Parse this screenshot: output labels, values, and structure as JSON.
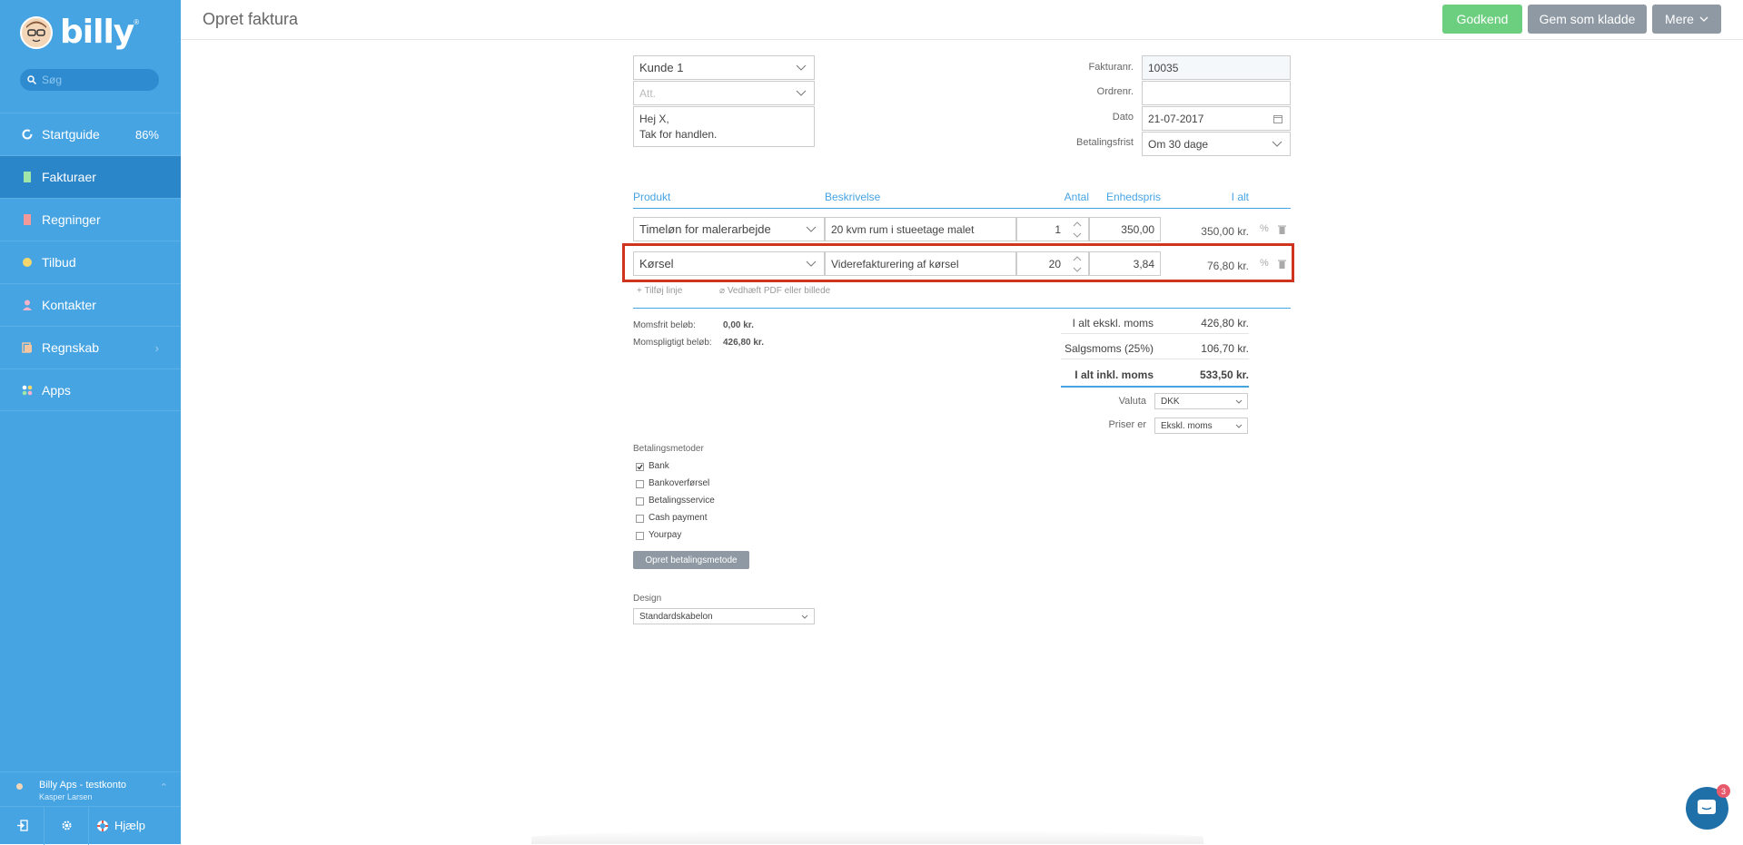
{
  "app": {
    "logo_text": "billy",
    "logo_mark": "®",
    "search_placeholder": "Søg"
  },
  "nav": [
    {
      "label": "Startguide",
      "badge": "86%",
      "icon": "progress-circle-icon"
    },
    {
      "label": "Fakturaer",
      "icon": "document-icon",
      "active": true
    },
    {
      "label": "Regninger",
      "icon": "bill-icon"
    },
    {
      "label": "Tilbud",
      "icon": "gear-badge-icon"
    },
    {
      "label": "Kontakter",
      "icon": "person-icon"
    },
    {
      "label": "Regnskab",
      "icon": "ledger-icon"
    },
    {
      "label": "Apps",
      "icon": "apps-icon"
    }
  ],
  "account": {
    "company": "Billy Aps - testkonto",
    "user": "Kasper Larsen"
  },
  "bottom": {
    "help": "Hjælp"
  },
  "header": {
    "title": "Opret faktura",
    "approve": "Godkend",
    "save_draft": "Gem som kladde",
    "more": "Mere"
  },
  "customer": {
    "name": "Kunde 1",
    "att_placeholder": "Att.",
    "message_line1": "Hej X,",
    "message_line2": "Tak for handlen."
  },
  "meta": {
    "invoice_no_label": "Fakturanr.",
    "invoice_no": "10035",
    "order_no_label": "Ordrenr.",
    "order_no": "",
    "date_label": "Dato",
    "date": "21-07-2017",
    "terms_label": "Betalingsfrist",
    "terms": "Om 30 dage"
  },
  "lines_header": {
    "product": "Produkt",
    "description": "Beskrivelse",
    "qty": "Antal",
    "unit_price": "Enhedspris",
    "total": "I alt"
  },
  "lines": [
    {
      "product": "Timeløn for malerarbejde",
      "description": "20 kvm rum i stueetage malet",
      "qty": "1",
      "unit_price": "350,00",
      "total": "350,00 kr."
    },
    {
      "product": "Kørsel",
      "description": "Viderefakturering af kørsel",
      "qty": "20",
      "unit_price": "3,84",
      "total": "76,80 kr.",
      "highlighted": true
    }
  ],
  "line_actions": {
    "add_line": "Tilføj linje",
    "attach": "Vedhæft PDF eller billede"
  },
  "summary": {
    "vat_free_label": "Momsfrit beløb:",
    "vat_free": "0,00 kr.",
    "vat_liable_label": "Momspligtigt beløb:",
    "vat_liable": "426,80 kr.",
    "excl_label": "I alt ekskl. moms",
    "excl": "426,80 kr.",
    "vat_label": "Salgsmoms (25%)",
    "vat": "106,70 kr.",
    "incl_label": "I alt inkl. moms",
    "incl": "533,50 kr.",
    "currency_label": "Valuta",
    "currency": "DKK",
    "prices_label": "Priser er",
    "prices": "Ekskl. moms"
  },
  "payment": {
    "title": "Betalingsmetoder",
    "methods": [
      {
        "label": "Bank",
        "checked": true
      },
      {
        "label": "Bankoverførsel",
        "checked": false
      },
      {
        "label": "Betalingsservice",
        "checked": false
      },
      {
        "label": "Cash payment",
        "checked": false
      },
      {
        "label": "Yourpay",
        "checked": false
      }
    ],
    "create_button": "Opret betalingsmetode"
  },
  "design": {
    "label": "Design",
    "value": "Standardskabelon"
  },
  "chat": {
    "unread": "3"
  },
  "colors": {
    "sidebar": "#47a4e3",
    "active": "#2a85c9",
    "approve": "#6ccf7f",
    "secondary": "#8e99a3",
    "highlight": "#d0341f",
    "accent": "#47a4e3"
  }
}
